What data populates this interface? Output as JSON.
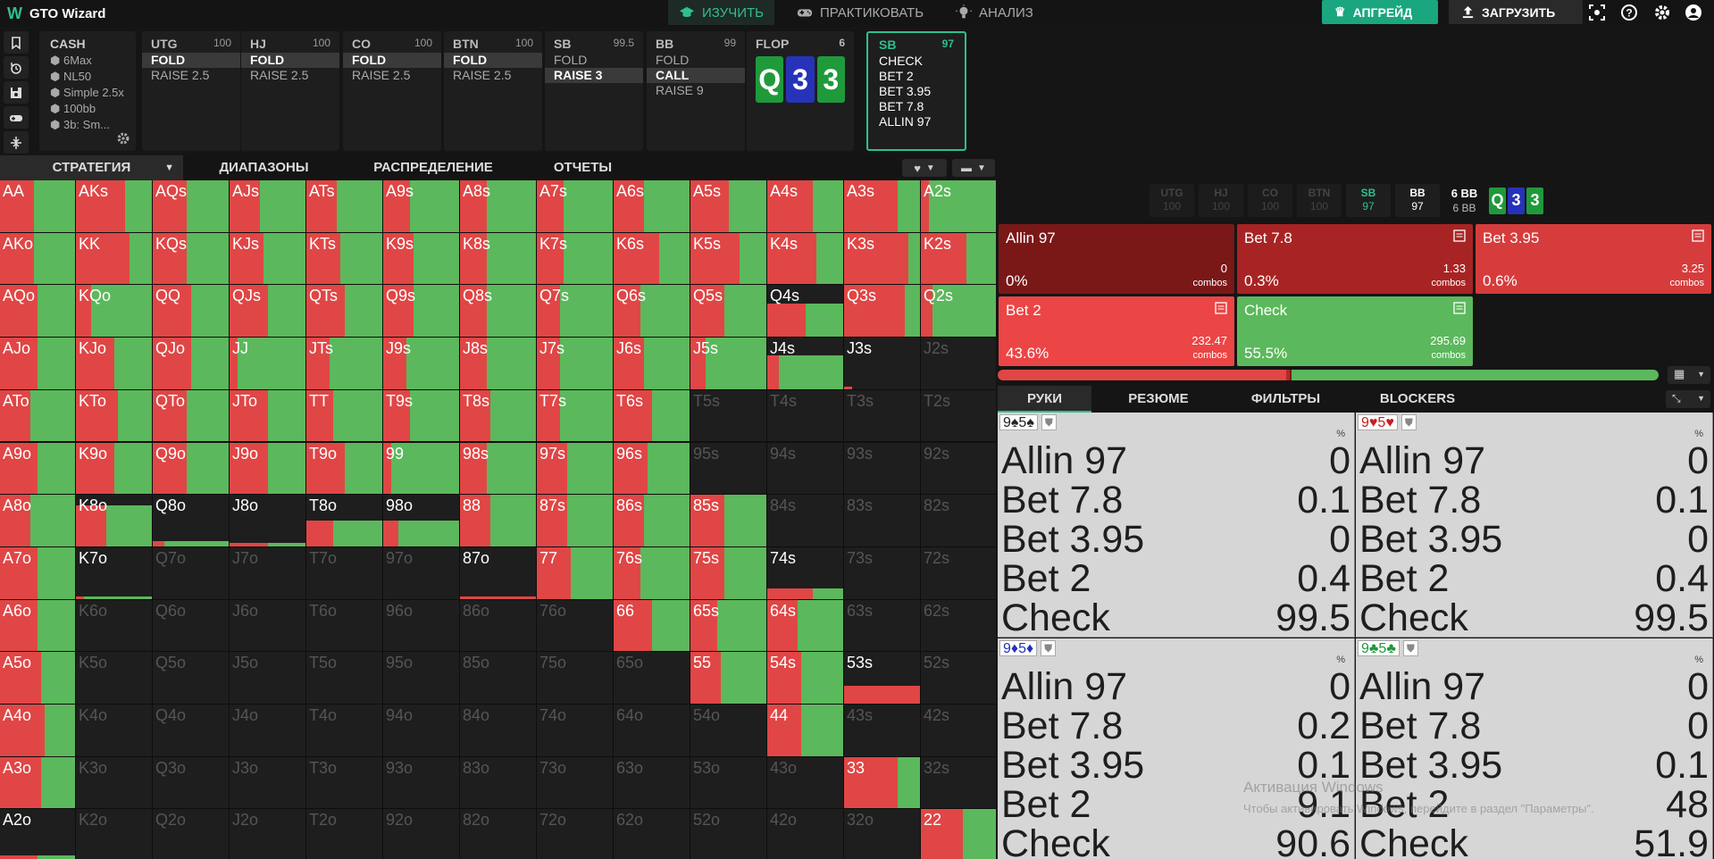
{
  "app": {
    "logo_letter": "W",
    "title": "GTO Wizard"
  },
  "nav": [
    {
      "label": "ИЗУЧИТЬ",
      "icon": "graduation-cap-icon",
      "active": true
    },
    {
      "label": "ПРАКТИКОВАТЬ",
      "icon": "gamepad-icon",
      "active": false
    },
    {
      "label": "АНАЛИЗ",
      "icon": "lightbulb-icon",
      "active": false
    }
  ],
  "top_buttons": {
    "upgrade": "АПГРЕЙД",
    "upload": "ЗАГРУЗИТЬ"
  },
  "sidetools": [
    "bookmark-icon",
    "history-icon",
    "save-icon",
    "gamepad-icon",
    "compress-icon"
  ],
  "cash": {
    "title": "CASH",
    "rows": [
      "6Max",
      "NL50",
      "Simple 2.5x",
      "100bb",
      "3b: Sm..."
    ]
  },
  "positions": [
    {
      "name": "UTG",
      "stack": "100",
      "actions": [
        "FOLD",
        "RAISE 2.5"
      ],
      "selected": 0
    },
    {
      "name": "HJ",
      "stack": "100",
      "actions": [
        "FOLD",
        "RAISE 2.5"
      ],
      "selected": 0
    },
    {
      "name": "CO",
      "stack": "100",
      "actions": [
        "FOLD",
        "RAISE 2.5"
      ],
      "selected": 0
    },
    {
      "name": "BTN",
      "stack": "100",
      "actions": [
        "FOLD",
        "RAISE 2.5"
      ],
      "selected": 0
    },
    {
      "name": "SB",
      "stack": "99.5",
      "actions": [
        "FOLD",
        "RAISE 3"
      ],
      "selected": 1
    },
    {
      "name": "BB",
      "stack": "99",
      "actions": [
        "FOLD",
        "CALL",
        "RAISE 9"
      ],
      "selected": 1
    }
  ],
  "flop": {
    "label": "FLOP",
    "pot": "6",
    "cards": [
      {
        "rank": "Q",
        "color": "#1f9a3b"
      },
      {
        "rank": "3",
        "color": "#2633b8"
      },
      {
        "rank": "3",
        "color": "#1f9a3b"
      }
    ]
  },
  "current_node": {
    "name": "SB",
    "stack": "97",
    "actions": [
      "CHECK",
      "BET 2",
      "BET 3.95",
      "BET 7.8",
      "ALLIN 97"
    ]
  },
  "tabs": [
    "СТРАТЕГИЯ",
    "ДИАПАЗОНЫ",
    "РАСПРЕДЕЛЕНИЕ",
    "ОТЧЕТЫ"
  ],
  "colors": {
    "green": "#5cb85c",
    "red": "#e04646",
    "dark_red": "#b22a2a",
    "darkest_red": "#7a1818",
    "accent": "#2fbf8f"
  },
  "grid": {
    "rows": [
      [
        "AA",
        "AKs",
        "AQs",
        "AJs",
        "ATs",
        "A9s",
        "A8s",
        "A7s",
        "A6s",
        "A5s",
        "A4s",
        "A3s",
        "A2s"
      ],
      [
        "AKo",
        "KK",
        "KQs",
        "KJs",
        "KTs",
        "K9s",
        "K8s",
        "K7s",
        "K6s",
        "K5s",
        "K4s",
        "K3s",
        "K2s"
      ],
      [
        "AQo",
        "KQo",
        "QQ",
        "QJs",
        "QTs",
        "Q9s",
        "Q8s",
        "Q7s",
        "Q6s",
        "Q5s",
        "Q4s",
        "Q3s",
        "Q2s"
      ],
      [
        "AJo",
        "KJo",
        "QJo",
        "JJ",
        "JTs",
        "J9s",
        "J8s",
        "J7s",
        "J6s",
        "J5s",
        "J4s",
        "J3s",
        "J2s"
      ],
      [
        "ATo",
        "KTo",
        "QTo",
        "JTo",
        "TT",
        "T9s",
        "T8s",
        "T7s",
        "T6s",
        "T5s",
        "T4s",
        "T3s",
        "T2s"
      ],
      [
        "A9o",
        "K9o",
        "Q9o",
        "J9o",
        "T9o",
        "99",
        "98s",
        "97s",
        "96s",
        "95s",
        "94s",
        "93s",
        "92s"
      ],
      [
        "A8o",
        "K8o",
        "Q8o",
        "J8o",
        "T8o",
        "98o",
        "88",
        "87s",
        "86s",
        "85s",
        "84s",
        "83s",
        "82s"
      ],
      [
        "A7o",
        "K7o",
        "Q7o",
        "J7o",
        "T7o",
        "97o",
        "87o",
        "77",
        "76s",
        "75s",
        "74s",
        "73s",
        "72s"
      ],
      [
        "A6o",
        "K6o",
        "Q6o",
        "J6o",
        "T6o",
        "96o",
        "86o",
        "76o",
        "66",
        "65s",
        "64s",
        "63s",
        "62s"
      ],
      [
        "A5o",
        "K5o",
        "Q5o",
        "J5o",
        "T5o",
        "95o",
        "85o",
        "75o",
        "65o",
        "55",
        "54s",
        "53s",
        "52s"
      ],
      [
        "A4o",
        "K4o",
        "Q4o",
        "J4o",
        "T4o",
        "94o",
        "84o",
        "74o",
        "64o",
        "54o",
        "44",
        "43s",
        "42s"
      ],
      [
        "A3o",
        "K3o",
        "Q3o",
        "J3o",
        "T3o",
        "93o",
        "83o",
        "73o",
        "63o",
        "53o",
        "43o",
        "33",
        "32s"
      ],
      [
        "A2o",
        "K2o",
        "Q2o",
        "J2o",
        "T2o",
        "92o",
        "82o",
        "72o",
        "62o",
        "52o",
        "42o",
        "32o",
        "22"
      ]
    ],
    "strategy": [
      [
        [
          0.45,
          0.55,
          1
        ],
        [
          0.65,
          0.35,
          1
        ],
        [
          0.45,
          0.55,
          1
        ],
        [
          0.4,
          0.6,
          1
        ],
        [
          0.4,
          0.6,
          1
        ],
        [
          0.35,
          0.65,
          1
        ],
        [
          0.35,
          0.65,
          1
        ],
        [
          0.35,
          0.65,
          1
        ],
        [
          0.4,
          0.6,
          1
        ],
        [
          0.5,
          0.5,
          1
        ],
        [
          0.6,
          0.4,
          1
        ],
        [
          0.7,
          0.3,
          1
        ],
        [
          0.1,
          0.9,
          1
        ]
      ],
      [
        [
          0.45,
          0.55,
          1
        ],
        [
          0.7,
          0.3,
          1
        ],
        [
          0.45,
          0.55,
          1
        ],
        [
          0.45,
          0.55,
          1
        ],
        [
          0.45,
          0.55,
          1
        ],
        [
          0.4,
          0.6,
          1
        ],
        [
          0.35,
          0.65,
          1
        ],
        [
          0.35,
          0.65,
          1
        ],
        [
          0.6,
          0.4,
          1
        ],
        [
          0.65,
          0.35,
          1
        ],
        [
          0.65,
          0.35,
          1
        ],
        [
          0.85,
          0.15,
          1
        ],
        [
          0.6,
          0.4,
          1
        ]
      ],
      [
        [
          0.5,
          0.5,
          1
        ],
        [
          0.2,
          0.8,
          1
        ],
        [
          0.5,
          0.5,
          1
        ],
        [
          0.5,
          0.5,
          1
        ],
        [
          0.5,
          0.5,
          1
        ],
        [
          0.4,
          0.6,
          1
        ],
        [
          0.35,
          0.65,
          1
        ],
        [
          0.3,
          0.7,
          1
        ],
        [
          0.35,
          0.65,
          1
        ],
        [
          0.45,
          0.55,
          1
        ],
        [
          0.5,
          0.5,
          0.65
        ],
        [
          0.8,
          0.2,
          1
        ],
        [
          0.15,
          0.85,
          1
        ]
      ],
      [
        [
          0.5,
          0.5,
          1
        ],
        [
          0.5,
          0.5,
          1
        ],
        [
          0.5,
          0.5,
          1
        ],
        [
          0.1,
          0.9,
          1
        ],
        [
          0.3,
          0.7,
          1
        ],
        [
          0.3,
          0.7,
          1
        ],
        [
          0.35,
          0.65,
          1
        ],
        [
          0.3,
          0.7,
          1
        ],
        [
          0.4,
          0.6,
          1
        ],
        [
          0.2,
          0.8,
          1
        ],
        [
          0.15,
          0.85,
          0.65
        ],
        [
          0.1,
          0,
          0.04
        ],
        [
          0,
          0,
          0
        ]
      ],
      [
        [
          0.4,
          0.6,
          1
        ],
        [
          0.55,
          0.45,
          1
        ],
        [
          0.45,
          0.55,
          1
        ],
        [
          0.5,
          0.5,
          1
        ],
        [
          0.35,
          0.65,
          1
        ],
        [
          0.35,
          0.65,
          1
        ],
        [
          0.4,
          0.6,
          1
        ],
        [
          0.3,
          0.7,
          1
        ],
        [
          0.5,
          0.5,
          1
        ],
        [
          0,
          0,
          0
        ],
        [
          0,
          0,
          0
        ],
        [
          0,
          0,
          0
        ],
        [
          0,
          0,
          0
        ]
      ],
      [
        [
          0.5,
          0.5,
          1
        ],
        [
          0.5,
          0.5,
          1
        ],
        [
          0.45,
          0.55,
          1
        ],
        [
          0.5,
          0.5,
          1
        ],
        [
          0.5,
          0.5,
          1
        ],
        [
          0.1,
          0.9,
          1
        ],
        [
          0.35,
          0.65,
          1
        ],
        [
          0.4,
          0.6,
          1
        ],
        [
          0.45,
          0.55,
          1
        ],
        [
          0,
          0,
          0
        ],
        [
          0,
          0,
          0
        ],
        [
          0,
          0,
          0
        ],
        [
          0,
          0,
          0
        ]
      ],
      [
        [
          0.4,
          0.6,
          1
        ],
        [
          0.4,
          0.6,
          0.8
        ],
        [
          0.15,
          0.85,
          0.1
        ],
        [
          0.5,
          0.5,
          0.06
        ],
        [
          0.35,
          0.65,
          0.5
        ],
        [
          0.2,
          0.8,
          0.5
        ],
        [
          0.4,
          0.6,
          1
        ],
        [
          0.4,
          0.6,
          1
        ],
        [
          0.4,
          0.6,
          1
        ],
        [
          0.45,
          0.55,
          1
        ],
        [
          0,
          0,
          0
        ],
        [
          0,
          0,
          0
        ],
        [
          0,
          0,
          0
        ]
      ],
      [
        [
          0.5,
          0.5,
          1
        ],
        [
          0.1,
          0.9,
          0.04
        ],
        [
          0,
          0,
          0
        ],
        [
          0,
          0,
          0
        ],
        [
          0,
          0,
          0
        ],
        [
          0,
          0,
          0
        ],
        [
          1,
          0,
          0.04
        ],
        [
          0.45,
          0.55,
          1
        ],
        [
          0.35,
          0.65,
          1
        ],
        [
          0.45,
          0.55,
          1
        ],
        [
          0.6,
          0.4,
          0.2
        ],
        [
          0,
          0,
          0
        ],
        [
          0,
          0,
          0
        ]
      ],
      [
        [
          0.5,
          0.5,
          1
        ],
        [
          0,
          0,
          0
        ],
        [
          0,
          0,
          0
        ],
        [
          0,
          0,
          0
        ],
        [
          0,
          0,
          0
        ],
        [
          0,
          0,
          0
        ],
        [
          0,
          0,
          0
        ],
        [
          0,
          0,
          0
        ],
        [
          0.5,
          0.5,
          1
        ],
        [
          0.35,
          0.65,
          1
        ],
        [
          0.4,
          0.6,
          1
        ],
        [
          0,
          0,
          0
        ],
        [
          0,
          0,
          0
        ]
      ],
      [
        [
          0.55,
          0.45,
          1
        ],
        [
          0,
          0,
          0
        ],
        [
          0,
          0,
          0
        ],
        [
          0,
          0,
          0
        ],
        [
          0,
          0,
          0
        ],
        [
          0,
          0,
          0
        ],
        [
          0,
          0,
          0
        ],
        [
          0,
          0,
          0
        ],
        [
          0,
          0,
          0
        ],
        [
          0.4,
          0.6,
          1
        ],
        [
          0.45,
          0.55,
          1
        ],
        [
          1,
          0,
          0.35
        ],
        [
          0,
          0,
          0
        ]
      ],
      [
        [
          0.6,
          0.4,
          1
        ],
        [
          0,
          0,
          0
        ],
        [
          0,
          0,
          0
        ],
        [
          0,
          0,
          0
        ],
        [
          0,
          0,
          0
        ],
        [
          0,
          0,
          0
        ],
        [
          0,
          0,
          0
        ],
        [
          0,
          0,
          0
        ],
        [
          0,
          0,
          0
        ],
        [
          0,
          0,
          0
        ],
        [
          0.45,
          0.55,
          1
        ],
        [
          0,
          0,
          0
        ],
        [
          0,
          0,
          0
        ]
      ],
      [
        [
          0.55,
          0.45,
          1
        ],
        [
          0,
          0,
          0
        ],
        [
          0,
          0,
          0
        ],
        [
          0,
          0,
          0
        ],
        [
          0,
          0,
          0
        ],
        [
          0,
          0,
          0
        ],
        [
          0,
          0,
          0
        ],
        [
          0,
          0,
          0
        ],
        [
          0,
          0,
          0
        ],
        [
          0,
          0,
          0
        ],
        [
          0,
          0,
          0
        ],
        [
          0.7,
          0.3,
          1
        ],
        [
          0,
          0,
          0
        ]
      ],
      [
        [
          0.5,
          0.5,
          0.1
        ],
        [
          0,
          0,
          0
        ],
        [
          0,
          0,
          0
        ],
        [
          0,
          0,
          0
        ],
        [
          0,
          0,
          0
        ],
        [
          0,
          0,
          0
        ],
        [
          0,
          0,
          0
        ],
        [
          0,
          0,
          0
        ],
        [
          0,
          0,
          0
        ],
        [
          0,
          0,
          0
        ],
        [
          0,
          0,
          0
        ],
        [
          0,
          0,
          0
        ],
        [
          0.55,
          0.45,
          1
        ]
      ]
    ]
  },
  "seat_strip": [
    {
      "name": "UTG",
      "stack": "100",
      "state": "off"
    },
    {
      "name": "HJ",
      "stack": "100",
      "state": "off"
    },
    {
      "name": "CO",
      "stack": "100",
      "state": "off"
    },
    {
      "name": "BTN",
      "stack": "100",
      "state": "off"
    },
    {
      "name": "SB",
      "stack": "97",
      "state": "active"
    },
    {
      "name": "BB",
      "stack": "97",
      "state": "on"
    }
  ],
  "pot": {
    "top": "6 BB",
    "bottom": "6 BB"
  },
  "actions": [
    {
      "name": "Allin 97",
      "freq": "0%",
      "combos": "0",
      "combos_label": "combos",
      "color": "#7a1818"
    },
    {
      "name": "Bet 7.8",
      "freq": "0.3%",
      "combos": "1.33",
      "combos_label": "combos",
      "color": "#a82424"
    },
    {
      "name": "Bet 3.95",
      "freq": "0.6%",
      "combos": "3.25",
      "combos_label": "combos",
      "color": "#d63c3c"
    },
    {
      "name": "Bet 2",
      "freq": "43.6%",
      "combos": "232.47",
      "combos_label": "combos",
      "color": "#ec4545"
    },
    {
      "name": "Check",
      "freq": "55.5%",
      "combos": "295.69",
      "combos_label": "combos",
      "color": "#5cb85c"
    }
  ],
  "freq_bar": {
    "bet2": 0.436,
    "bet395": 0.006,
    "bet78": 0.003,
    "check": 0.555
  },
  "hand_tabs": [
    "РУКИ",
    "РЕЗЮМЕ",
    "ФИЛЬТРЫ",
    "BLOCKERS"
  ],
  "hands": [
    {
      "rank1": "9",
      "suit1": "♠",
      "rank2": "5",
      "suit2": "♠",
      "color": "#222222",
      "rows": [
        [
          "Allin 97",
          "0"
        ],
        [
          "Bet 7.8",
          "0.1"
        ],
        [
          "Bet 3.95",
          "0"
        ],
        [
          "Bet 2",
          "0.4"
        ],
        [
          "Check",
          "99.5"
        ]
      ]
    },
    {
      "rank1": "9",
      "suit1": "♥",
      "rank2": "5",
      "suit2": "♥",
      "color": "#c81e1e",
      "rows": [
        [
          "Allin 97",
          "0"
        ],
        [
          "Bet 7.8",
          "0.1"
        ],
        [
          "Bet 3.95",
          "0"
        ],
        [
          "Bet 2",
          "0.4"
        ],
        [
          "Check",
          "99.5"
        ]
      ]
    },
    {
      "rank1": "9",
      "suit1": "♦",
      "rank2": "5",
      "suit2": "♦",
      "color": "#2233bb",
      "rows": [
        [
          "Allin 97",
          "0"
        ],
        [
          "Bet 7.8",
          "0.2"
        ],
        [
          "Bet 3.95",
          "0.1"
        ],
        [
          "Bet 2",
          "9.1"
        ],
        [
          "Check",
          "90.6"
        ]
      ]
    },
    {
      "rank1": "9",
      "suit1": "♣",
      "rank2": "5",
      "suit2": "♣",
      "color": "#1f9a3b",
      "rows": [
        [
          "Allin 97",
          "0"
        ],
        [
          "Bet 7.8",
          "0"
        ],
        [
          "Bet 3.95",
          "0.1"
        ],
        [
          "Bet 2",
          "48"
        ],
        [
          "Check",
          "51.9"
        ]
      ]
    }
  ],
  "pct_label": "%",
  "watermark": {
    "line1": "Активация Windows",
    "line2": "Чтобы активировать Windows, перейдите в раздел \"Параметры\"."
  }
}
